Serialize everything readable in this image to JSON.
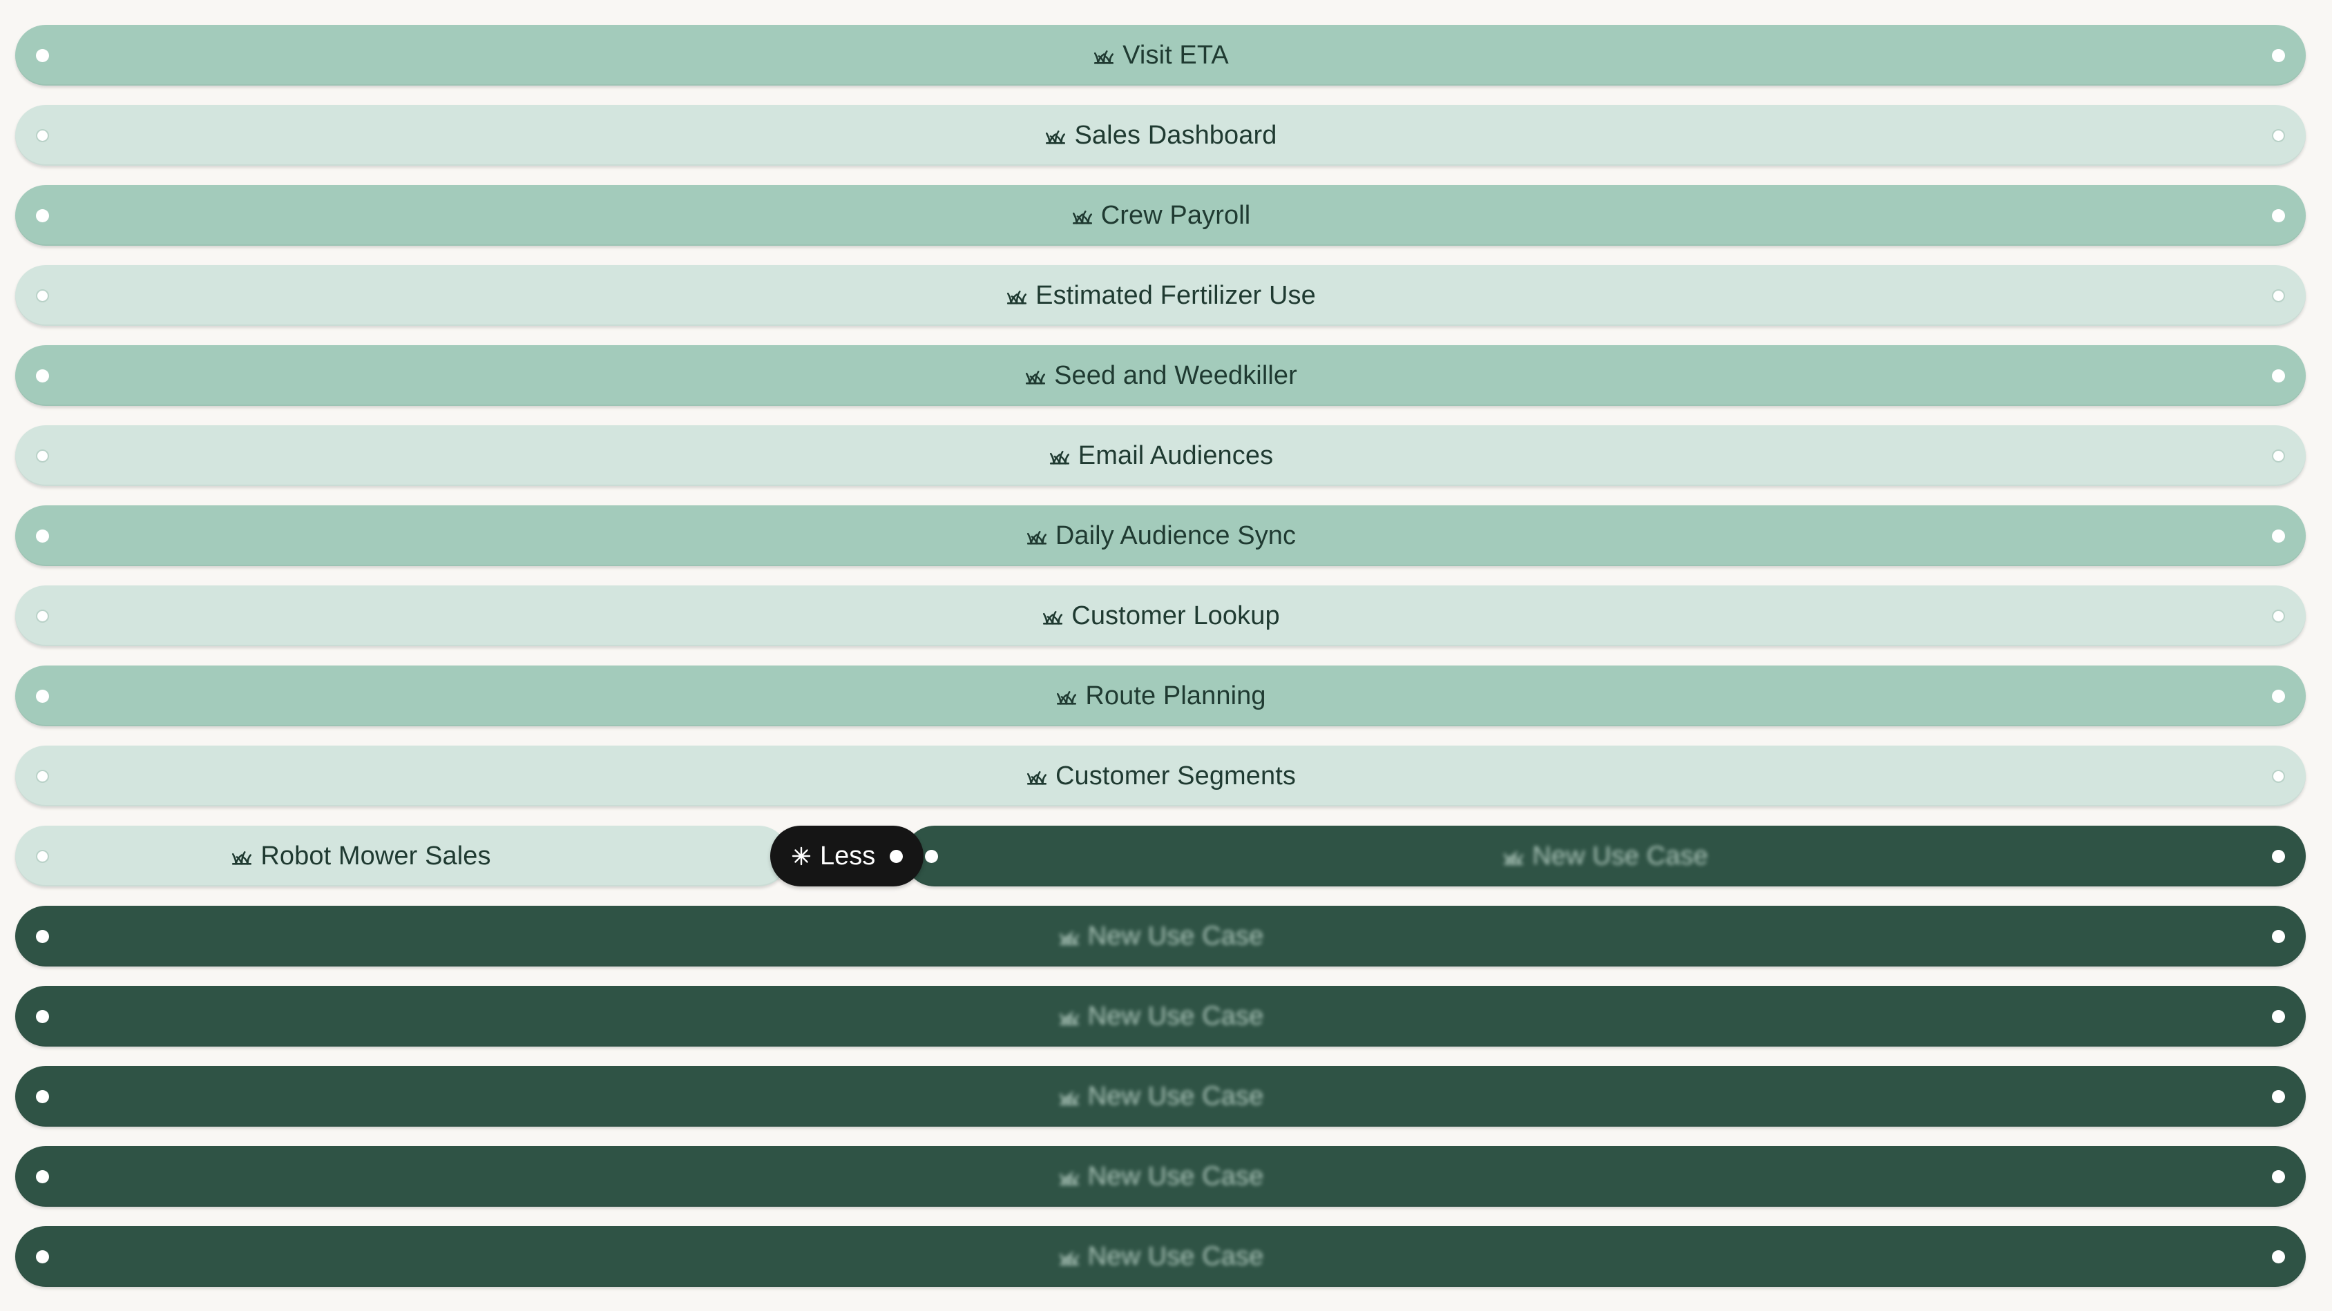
{
  "colors": {
    "background": "#f9f7f4",
    "pill_medium": "#a3cbbb",
    "pill_light": "#d3e5de",
    "pill_dark": "#2f5345",
    "less_button": "#151515",
    "text_dark": "#1f3a31"
  },
  "use_cases": [
    {
      "label": "Visit ETA",
      "variant": "medium",
      "icon": "grass-icon"
    },
    {
      "label": "Sales Dashboard",
      "variant": "light",
      "icon": "grass-icon"
    },
    {
      "label": "Crew Payroll",
      "variant": "medium",
      "icon": "grass-icon"
    },
    {
      "label": "Estimated Fertilizer Use",
      "variant": "light",
      "icon": "grass-icon"
    },
    {
      "label": "Seed and Weedkiller",
      "variant": "medium",
      "icon": "grass-icon"
    },
    {
      "label": "Email Audiences",
      "variant": "light",
      "icon": "grass-icon"
    },
    {
      "label": "Daily Audience Sync",
      "variant": "medium",
      "icon": "grass-icon"
    },
    {
      "label": "Customer Lookup",
      "variant": "light",
      "icon": "grass-icon"
    },
    {
      "label": "Route Planning",
      "variant": "medium",
      "icon": "grass-icon"
    },
    {
      "label": "Customer Segments",
      "variant": "light",
      "icon": "grass-icon"
    }
  ],
  "split_row": {
    "left": {
      "label": "Robot Mower Sales",
      "variant": "light",
      "icon": "grass-icon"
    },
    "less_button": {
      "label": "Less",
      "icon": "asterisk-icon"
    },
    "right": {
      "label": "New Use Case",
      "variant": "dark",
      "icon": "grass-icon"
    }
  },
  "new_use_cases": [
    {
      "label": "New Use Case",
      "variant": "dark",
      "icon": "grass-icon"
    },
    {
      "label": "New Use Case",
      "variant": "dark",
      "icon": "grass-icon"
    },
    {
      "label": "New Use Case",
      "variant": "dark",
      "icon": "grass-icon"
    },
    {
      "label": "New Use Case",
      "variant": "dark",
      "icon": "grass-icon"
    },
    {
      "label": "New Use Case",
      "variant": "dark",
      "icon": "grass-icon"
    }
  ]
}
